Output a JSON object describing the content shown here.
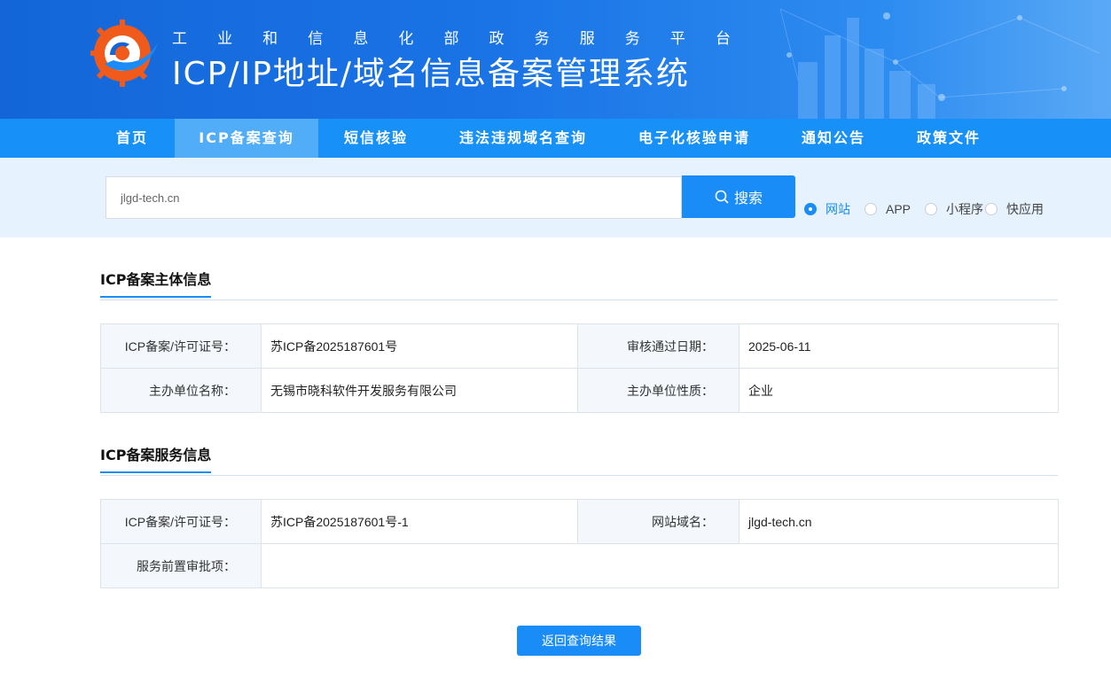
{
  "header": {
    "subtitle_chars": [
      "工",
      "业",
      "和",
      "信",
      "息",
      "化",
      "部",
      "政",
      "务",
      "服",
      "务",
      "平",
      "台"
    ],
    "title": "ICP/IP地址/域名信息备案管理系统"
  },
  "nav": {
    "items": [
      {
        "label": "首页"
      },
      {
        "label": "ICP备案查询"
      },
      {
        "label": "短信核验"
      },
      {
        "label": "违法违规域名查询"
      },
      {
        "label": "电子化核验申请"
      },
      {
        "label": "通知公告"
      },
      {
        "label": "政策文件"
      }
    ],
    "active": "ICP备案查询"
  },
  "search": {
    "value": "jlgd-tech.cn",
    "button_label": "搜索",
    "button_icon": "search-icon",
    "types": [
      {
        "label": "网站",
        "checked": true
      },
      {
        "label": "APP",
        "checked": false
      },
      {
        "label": "小程序",
        "checked": false
      },
      {
        "label": "快应用",
        "checked": false
      }
    ]
  },
  "subject_info": {
    "title": "ICP备案主体信息",
    "rows": [
      {
        "label1": "ICP备案/许可证号：",
        "value1": "苏ICP备2025187601号",
        "label2": "审核通过日期：",
        "value2": "2025-06-11"
      },
      {
        "label1": "主办单位名称：",
        "value1": "无锡市晓科软件开发服务有限公司",
        "label2": "主办单位性质：",
        "value2": "企业"
      }
    ]
  },
  "service_info": {
    "title": "ICP备案服务信息",
    "license_label": "ICP备案/许可证号：",
    "license_value": "苏ICP备2025187601号-1",
    "domain_label": "网站域名：",
    "domain_value": "jlgd-tech.cn",
    "approval_label": "服务前置审批项：",
    "approval_value": ""
  },
  "footer": {
    "back_label": "返回查询结果"
  },
  "colors": {
    "primary": "#1a8cf8",
    "nav_bg": "#1790f7",
    "nav_active": "#52adf9",
    "search_band": "#e6f2fd",
    "label_bg": "#f4f8fc"
  }
}
